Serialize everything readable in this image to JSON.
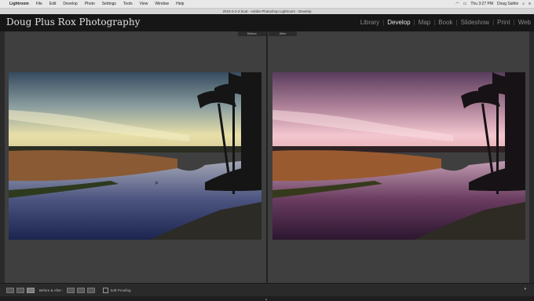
{
  "menubar": {
    "app": "Lightroom",
    "items": [
      "File",
      "Edit",
      "Develop",
      "Photo",
      "Settings",
      "Tools",
      "View",
      "Window",
      "Help"
    ],
    "clock": "Thu 3:27 PM",
    "user": "Doug Sahlin"
  },
  "window": {
    "title": "2015-2-2-2.lrcat - Adobe Photoshop Lightroom - Develop"
  },
  "identity_plate": "Doug Plus Rox Photography",
  "modules": [
    "Library",
    "Develop",
    "Map",
    "Book",
    "Slideshow",
    "Print",
    "Web"
  ],
  "active_module": "Develop",
  "panes": {
    "before_label": "Before",
    "after_label": "After"
  },
  "toolbar": {
    "before_after_label": "Before & After :",
    "soft_proofing_label": "Soft Proofing"
  },
  "colors": {
    "before_sky_top": "#3c4f63",
    "before_sky_horizon": "#e8e0a8",
    "after_sky_top": "#5c3f60",
    "after_sky_horizon": "#f3c6cf",
    "identity_bg": "#161616"
  },
  "icons": {
    "apple": "apple-icon",
    "loupe": "zoom-cursor-icon",
    "toolbar_view_loupe": "loupe-view-icon",
    "toolbar_view_grid": "grid-view-icon",
    "toolbar_before_after": "before-after-view-icon",
    "toolbar_swap": "swap-icon",
    "toolbar_copy": "copy-settings-icon"
  }
}
